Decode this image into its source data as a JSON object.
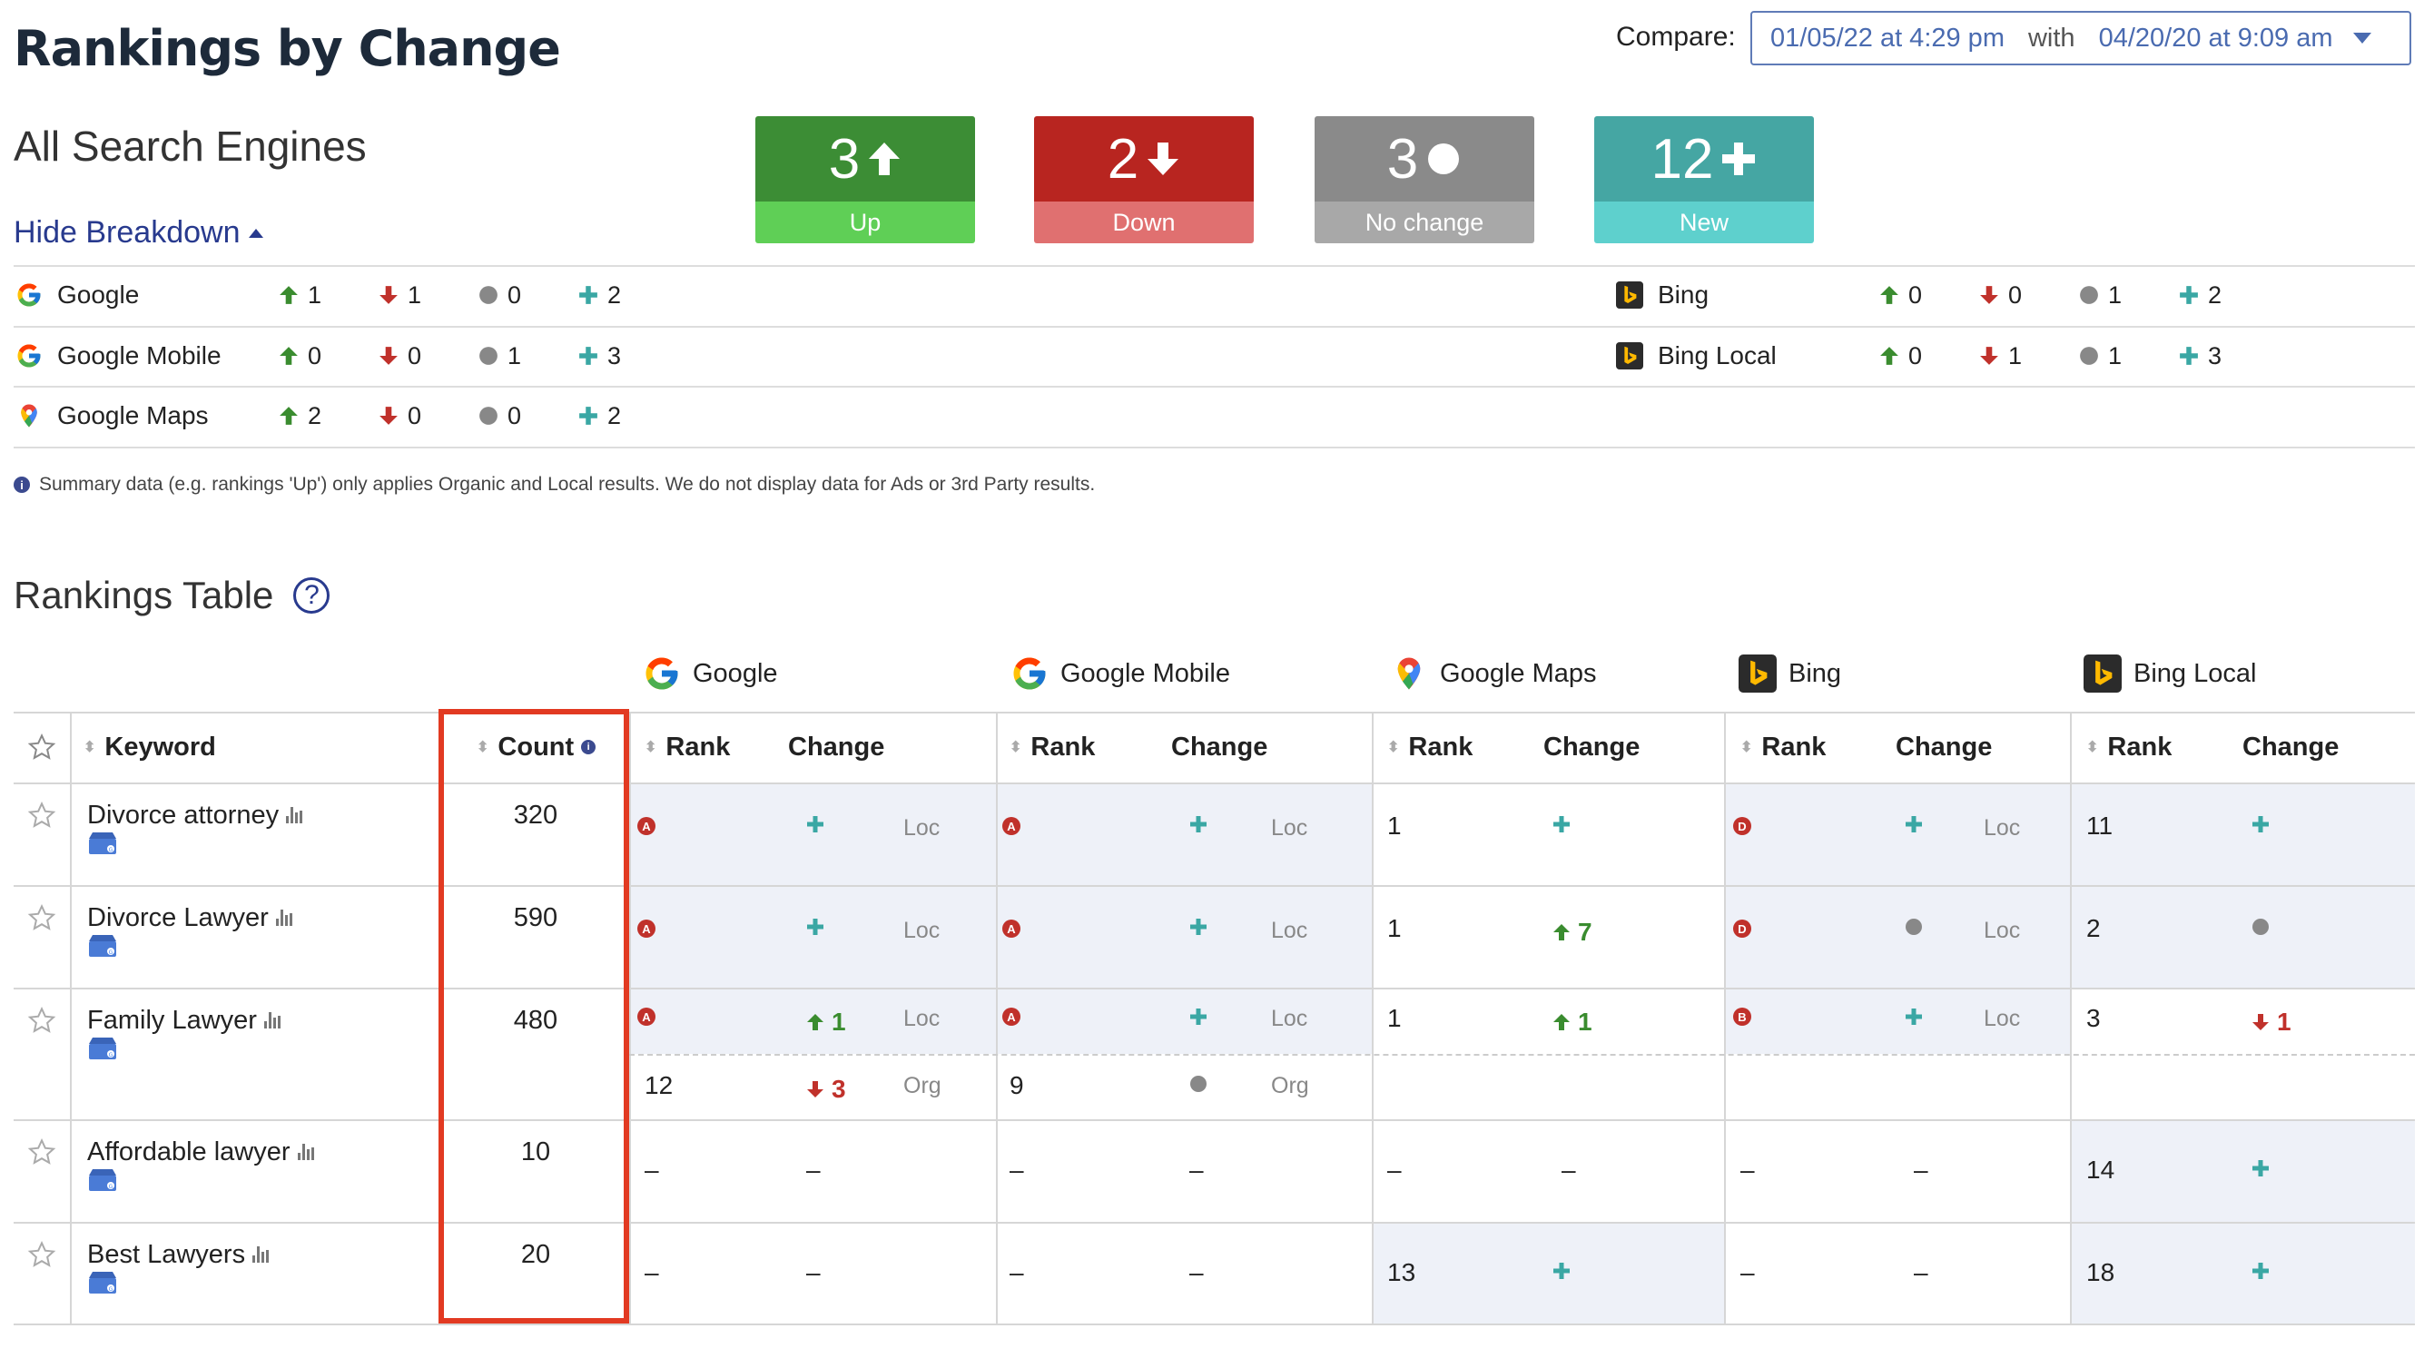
{
  "header": {
    "title": "Rankings by Change",
    "compare_label": "Compare:",
    "compare_from": "01/05/22 at 4:29 pm",
    "compare_with": "with",
    "compare_to": "04/20/20 at 9:09 am"
  },
  "subtitle": "All Search Engines",
  "hide_breakdown": "Hide Breakdown",
  "stats": [
    {
      "value": "3",
      "label": "Up",
      "color_top": "#3c8d35",
      "color_bottom": "#5fcf56"
    },
    {
      "value": "2",
      "label": "Down",
      "color_top": "#b82520",
      "color_bottom": "#e07070"
    },
    {
      "value": "3",
      "label": "No change",
      "color_top": "#8a8a8a",
      "color_bottom": "#a8a8a8"
    },
    {
      "value": "12",
      "label": "New",
      "color_top": "#45a6a3",
      "color_bottom": "#5ed0cd"
    }
  ],
  "breakdown": [
    {
      "engine": "Google",
      "up": "1",
      "down": "1",
      "same": "0",
      "new": "2"
    },
    {
      "engine": "Google Mobile",
      "up": "0",
      "down": "0",
      "same": "1",
      "new": "3"
    },
    {
      "engine": "Google Maps",
      "up": "2",
      "down": "0",
      "same": "0",
      "new": "2"
    },
    {
      "engine": "Bing",
      "up": "0",
      "down": "0",
      "same": "1",
      "new": "2"
    },
    {
      "engine": "Bing Local",
      "up": "0",
      "down": "1",
      "same": "1",
      "new": "3"
    }
  ],
  "note": "Summary data (e.g. rankings 'Up') only applies Organic and Local results. We do not display data for Ads or 3rd Party results.",
  "table_title": "Rankings Table",
  "engines": [
    "Google",
    "Google Mobile",
    "Google Maps",
    "Bing",
    "Bing Local"
  ],
  "columns": {
    "keyword": "Keyword",
    "count": "Count",
    "rank": "Rank",
    "change": "Change"
  },
  "rows": [
    {
      "keyword": "Divorce attorney",
      "count": "320"
    },
    {
      "keyword": "Divorce Lawyer",
      "count": "590"
    },
    {
      "keyword": "Family Lawyer",
      "count": "480"
    },
    {
      "keyword": "Affordable lawyer",
      "count": "10"
    },
    {
      "keyword": "Best Lawyers",
      "count": "20"
    }
  ],
  "labels": {
    "loc": "Loc",
    "org": "Org",
    "dash": "–"
  },
  "values": {
    "r1_maps_rank": "1",
    "r1_bl_rank": "11",
    "r2_maps_rank": "1",
    "r2_maps_change": "7",
    "r2_bl_rank": "2",
    "r3_g_change": "1",
    "r3_maps_rank": "1",
    "r3_maps_change": "1",
    "r3_bl_rank": "3",
    "r3_bl_change": "1",
    "r3_g_org_rank": "12",
    "r3_g_org_change": "3",
    "r3_gm_org_rank": "9",
    "r4_bl_rank": "14",
    "r5_maps_rank": "13",
    "r5_bl_rank": "18"
  },
  "badges": {
    "a": "A",
    "b": "B",
    "d": "D"
  },
  "colors": {
    "up": "#3a8c2f",
    "down": "#c0312b",
    "same": "#777777",
    "new": "#3aa7a4",
    "accent": "#283a8e",
    "highlight": "#e23a22"
  }
}
